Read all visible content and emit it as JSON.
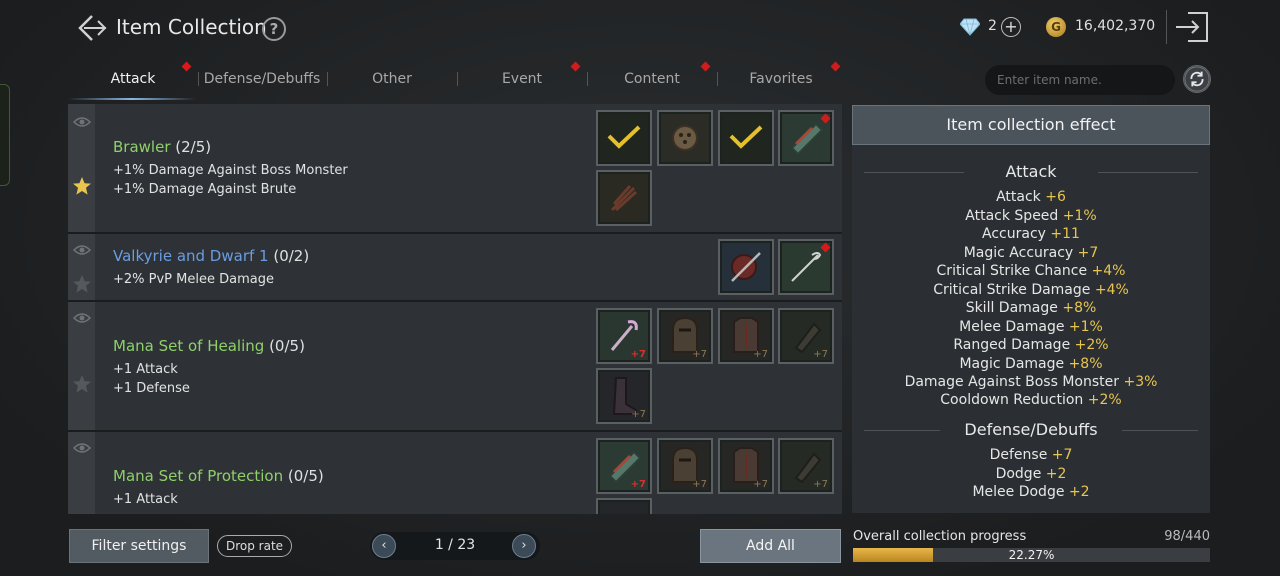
{
  "header": {
    "title": "Item Collection",
    "help": "?",
    "gems": "2",
    "plus": "+",
    "gold_symbol": "G",
    "gold": "16,402,370"
  },
  "tabs": [
    {
      "label": "Attack",
      "active": true,
      "notify": true
    },
    {
      "label": "Defense/Debuffs",
      "active": false,
      "notify": false
    },
    {
      "label": "Other",
      "active": false,
      "notify": false
    },
    {
      "label": "Event",
      "active": false,
      "notify": true
    },
    {
      "label": "Content",
      "active": false,
      "notify": true
    },
    {
      "label": "Favorites",
      "active": false,
      "notify": true
    }
  ],
  "search": {
    "placeholder": "Enter item name."
  },
  "collections": [
    {
      "name": "Brawler",
      "count": "(2/5)",
      "stats": [
        "+1% Damage Against Boss Monster",
        "+1% Damage Against Brute"
      ],
      "favorite": true
    },
    {
      "name": "Valkyrie and Dwarf 1",
      "count": "(0/2)",
      "stats": [
        "+2% PvP Melee Damage"
      ],
      "favorite": false
    },
    {
      "name": "Mana Set of Healing",
      "count": "(0/5)",
      "stats": [
        "+1 Attack",
        "+1 Defense"
      ],
      "favorite": false
    },
    {
      "name": "Mana Set of Protection",
      "count": "(0/5)",
      "stats": [
        "+1 Attack"
      ],
      "favorite": false
    }
  ],
  "enhance": {
    "plus7": "+7"
  },
  "effect_panel": {
    "title": "Item collection effect",
    "sections": [
      {
        "title": "Attack",
        "lines": [
          {
            "label": "Attack",
            "value": "+6"
          },
          {
            "label": "Attack Speed",
            "value": "+1%"
          },
          {
            "label": "Accuracy",
            "value": "+11"
          },
          {
            "label": "Magic Accuracy",
            "value": "+7"
          },
          {
            "label": "Critical Strike Chance",
            "value": "+4%"
          },
          {
            "label": "Critical Strike Damage",
            "value": "+4%"
          },
          {
            "label": "Skill Damage",
            "value": "+8%"
          },
          {
            "label": "Melee Damage",
            "value": "+1%"
          },
          {
            "label": "Ranged Damage",
            "value": "+2%"
          },
          {
            "label": "Magic Damage",
            "value": "+8%"
          },
          {
            "label": "Damage Against Boss Monster",
            "value": "+3%"
          },
          {
            "label": "Cooldown Reduction",
            "value": "+2%"
          }
        ]
      },
      {
        "title": "Defense/Debuffs",
        "lines": [
          {
            "label": "Defense",
            "value": "+7"
          },
          {
            "label": "Dodge",
            "value": "+2"
          },
          {
            "label": "Melee Dodge",
            "value": "+2"
          }
        ]
      }
    ]
  },
  "bottom": {
    "filter_label": "Filter settings",
    "drop_rate_label": "Drop rate",
    "prev": "‹",
    "next": "›",
    "page_text": "1 / 23",
    "add_all_label": "Add All",
    "progress_label": "Overall collection progress",
    "progress_count": "98/440",
    "progress_pct": "22.27%",
    "progress_fraction": 0.2227
  },
  "colors": {
    "accent_gold": "#e8c54f",
    "collection_green": "#8fd06a",
    "collection_blue": "#6a9de0",
    "notify_red": "#d31b1b"
  }
}
